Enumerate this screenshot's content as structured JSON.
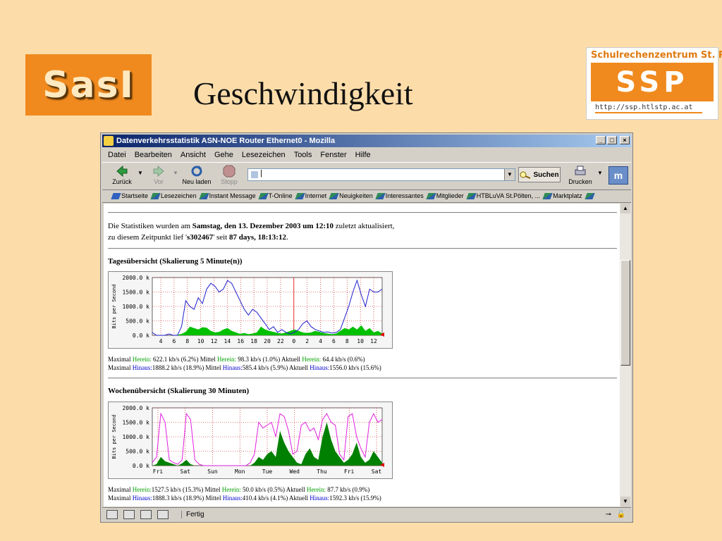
{
  "slide": {
    "title": "Geschwindigkeit",
    "logo_left": "SasI",
    "logo_right_top": "Schulrechenzentrum St. Pölten",
    "logo_right_main": "SSP",
    "logo_right_url": "http://ssp.htlstp.ac.at"
  },
  "window": {
    "title": "Datenverkehrsstatistik ASN-NOE Router Ethernet0 - Mozilla",
    "menu": [
      "Datei",
      "Bearbeiten",
      "Ansicht",
      "Gehe",
      "Lesezeichen",
      "Tools",
      "Fenster",
      "Hilfe"
    ],
    "nav": {
      "back": "Zurück",
      "forward": "Vor",
      "reload": "Neu laden",
      "stop": "Stopp",
      "search": "Suchen",
      "print": "Drucken"
    },
    "url_value": "|",
    "bookmarks": [
      "Startseite",
      "Lesezeichen",
      "Instant Message",
      "T-Online",
      "Internet",
      "Neuigkeiten",
      "Interessantes",
      "Mitglieder",
      "HTBLuVA St.Pölten, ...",
      "Marktplatz"
    ],
    "status": "Fertig"
  },
  "page": {
    "intro_line1_a": "Die Statistiken wurden am ",
    "intro_line1_b": "Samstag, den 13. Dezember 2003 um 12:10",
    "intro_line1_c": " zuletzt aktualisiert,",
    "intro_line2_a": "zu diesem Zeitpunkt lief '",
    "intro_line2_b": "s302467",
    "intro_line2_c": "' seit ",
    "intro_line2_d": "87 days, 18:13:12",
    "intro_line2_e": ".",
    "daily_heading": "Tagesübersicht (Skalierung 5 Minute(n))",
    "weekly_heading": "Wochenübersicht (Skalierung 30 Minuten)",
    "daily_stats": {
      "row1": {
        "a": "Maximal ",
        "b": "Herein:",
        "c": "    622.1 kb/s (6.2%)  Mittel ",
        "d": "Herein:",
        "e": "  98.3 kb/s (1.0%)  Aktuell ",
        "f": "Herein:",
        "g": "     64.4 kb/s (0.6%)"
      },
      "row2": {
        "a": "Maximal ",
        "b": "Hinaus:",
        "c": "1888.2 kb/s (18.9%)  Mittel ",
        "d": "Hinaus:",
        "e": "585.4 kb/s (5.9%)  Aktuell ",
        "f": "Hinaus:",
        "g": "1556.0 kb/s (15.6%)"
      }
    },
    "weekly_stats": {
      "row1": {
        "a": "Maximal ",
        "b": "Herein:",
        "c": "1527.5 kb/s (15.3%)  Mittel ",
        "d": "Herein:",
        "e": "  50.0 kb/s (0.5%)  Aktuell ",
        "f": "Herein:",
        "g": "     87.7 kb/s (0.9%)"
      },
      "row2": {
        "a": "Maximal ",
        "b": "Hinaus:",
        "c": "1888.3 kb/s (18.9%)  Mittel ",
        "d": "Hinaus:",
        "e": "410.4 kb/s (4.1%)  Aktuell ",
        "f": "Hinaus:",
        "g": "1592.3 kb/s (15.9%)"
      }
    }
  },
  "chart_data": [
    {
      "type": "area",
      "ylabel": "Bits per Second",
      "y_ticks": [
        "2000.0 k",
        "1500.0 k",
        "1000.0 k",
        "500.0 k",
        "0.0 k"
      ],
      "y_values": [
        2000,
        1500,
        1000,
        500,
        0
      ],
      "x_ticks": [
        "4",
        "6",
        "8",
        "10",
        "12",
        "14",
        "16",
        "18",
        "20",
        "22",
        "0",
        "2",
        "4",
        "6",
        "8",
        "10",
        "12"
      ],
      "ylim": [
        0,
        2000
      ],
      "series": [
        {
          "name": "Herein",
          "color": "#00C000",
          "values": [
            0,
            0,
            0,
            0,
            0,
            10,
            20,
            50,
            120,
            300,
            250,
            200,
            280,
            260,
            150,
            100,
            120,
            200,
            250,
            150,
            100,
            50,
            80,
            40,
            60,
            100,
            300,
            200,
            150,
            120,
            80,
            60,
            100,
            150,
            200,
            150,
            100,
            80,
            100,
            150,
            120,
            80,
            60,
            40,
            60,
            150,
            250,
            200,
            300,
            200,
            350,
            150,
            250,
            100,
            150,
            60
          ]
        },
        {
          "name": "Hinaus",
          "color": "#1F1FD0",
          "values": [
            100,
            0,
            0,
            0,
            50,
            0,
            0,
            300,
            1200,
            1000,
            900,
            1300,
            1100,
            1600,
            1800,
            1700,
            1500,
            1600,
            1900,
            1800,
            1500,
            1200,
            900,
            700,
            900,
            800,
            600,
            400,
            200,
            300,
            100,
            200,
            100,
            50,
            100,
            200,
            400,
            500,
            300,
            200,
            150,
            100,
            120,
            80,
            100,
            200,
            600,
            1000,
            1500,
            1900,
            1400,
            1000,
            1600,
            1500,
            1500,
            1600
          ]
        }
      ]
    },
    {
      "type": "area",
      "ylabel": "Bits per Second",
      "y_ticks": [
        "2000.0 k",
        "1500.0 k",
        "1000.0 k",
        "500.0 k",
        "0.0 k"
      ],
      "y_values": [
        2000,
        1500,
        1000,
        500,
        0
      ],
      "x_ticks": [
        "Fri",
        "Sat",
        "Sun",
        "Mon",
        "Tue",
        "Wed",
        "Thu",
        "Fri",
        "Sat"
      ],
      "ylim": [
        0,
        2000
      ],
      "series": [
        {
          "name": "Herein",
          "color": "#008000",
          "values": [
            0,
            50,
            300,
            150,
            100,
            50,
            0,
            80,
            200,
            50,
            0,
            0,
            0,
            0,
            0,
            0,
            0,
            0,
            0,
            0,
            0,
            0,
            0,
            0,
            100,
            300,
            200,
            400,
            500,
            300,
            1200,
            800,
            500,
            300,
            100,
            50,
            400,
            600,
            300,
            200,
            1000,
            1500,
            900,
            500,
            300,
            100,
            200,
            400,
            800,
            300,
            100,
            200,
            500,
            300,
            100
          ]
        },
        {
          "name": "Hinaus",
          "color": "#E020E0",
          "values": [
            100,
            300,
            1800,
            1500,
            200,
            100,
            50,
            200,
            1800,
            1600,
            200,
            50,
            0,
            0,
            0,
            0,
            0,
            0,
            0,
            0,
            0,
            0,
            0,
            100,
            400,
            1500,
            1300,
            1400,
            1500,
            1000,
            1800,
            1700,
            1200,
            400,
            500,
            1400,
            1500,
            1200,
            1300,
            900,
            1600,
            1800,
            1500,
            1400,
            400,
            200,
            1700,
            1800,
            1000,
            600,
            300,
            1500,
            1800,
            1500,
            1600
          ]
        }
      ]
    }
  ]
}
